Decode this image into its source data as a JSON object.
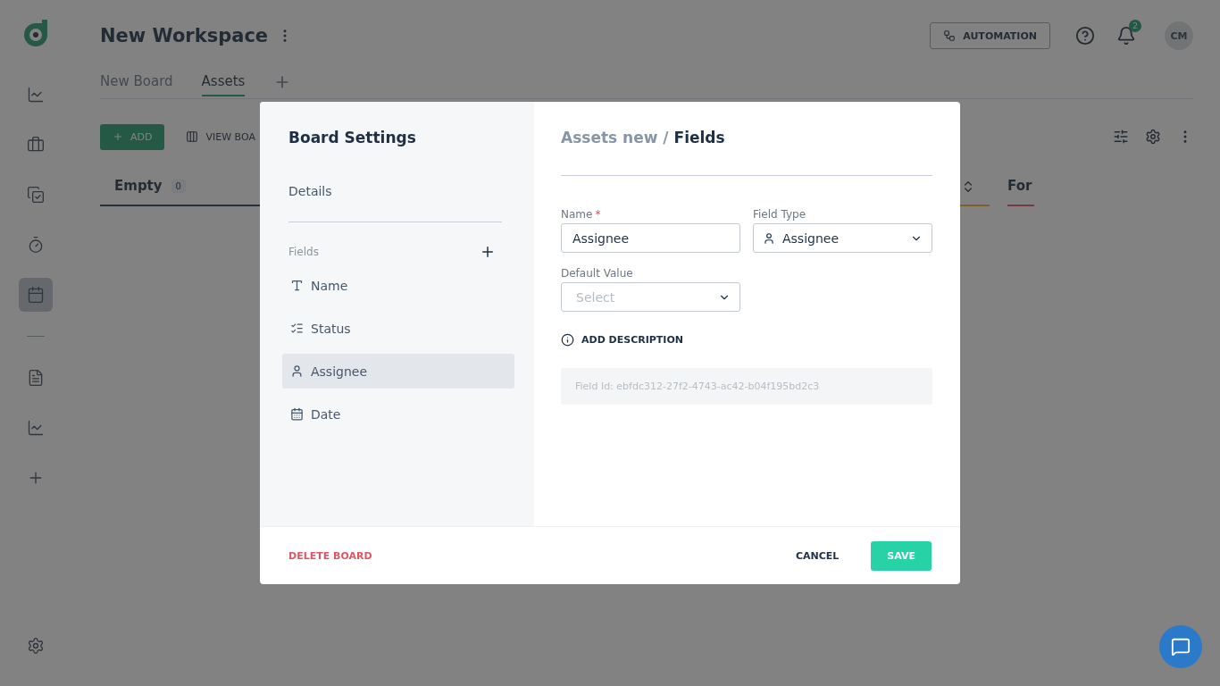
{
  "workspace": {
    "title": "New Workspace"
  },
  "tabs": [
    {
      "label": "New Board",
      "selected": false
    },
    {
      "label": "Assets",
      "selected": true
    }
  ],
  "header": {
    "automation": "AUTOMATION",
    "notifications": "2",
    "avatar": "CM"
  },
  "sidebar": {
    "items": [
      {
        "kind": "chart",
        "selected": false
      },
      {
        "kind": "briefcase",
        "selected": false
      },
      {
        "kind": "tasks",
        "selected": false
      },
      {
        "kind": "timer",
        "selected": false
      },
      {
        "kind": "calendar",
        "selected": true
      },
      {
        "kind": "divider"
      },
      {
        "kind": "doc",
        "selected": false
      },
      {
        "kind": "chart",
        "selected": false
      },
      {
        "kind": "plus",
        "selected": false
      }
    ]
  },
  "toolbar": {
    "add": "ADD",
    "view": "VIEW BOA"
  },
  "columns": [
    {
      "kind": "neutral",
      "title": "Empty",
      "count": "0"
    },
    {
      "kind": "warning"
    },
    {
      "kind": "danger",
      "title": "For"
    }
  ],
  "modal": {
    "title": "Board Settings",
    "details": "Details",
    "fields_label": "Fields",
    "fields": [
      {
        "kind": "text",
        "label": "Name",
        "selected": false
      },
      {
        "kind": "status",
        "label": "Status",
        "selected": false
      },
      {
        "kind": "person",
        "label": "Assignee",
        "selected": true
      },
      {
        "kind": "date",
        "label": "Date",
        "selected": false
      }
    ],
    "breadcrumb": {
      "parent": "Assets new /",
      "current": "Fields"
    },
    "name_label": "Name",
    "required_mark": "*",
    "name_value": "Assignee",
    "type_label": "Field Type",
    "type_value": "Assignee",
    "default_label": "Default Value",
    "default_placeholder": "Select",
    "add_description": "ADD DESCRIPTION",
    "field_id": "Field Id: ebfdc312-27f2-4743-ac42-b04f195bd2c3",
    "delete": "DELETE BOARD",
    "cancel": "CANCEL",
    "save": "SAVE"
  }
}
